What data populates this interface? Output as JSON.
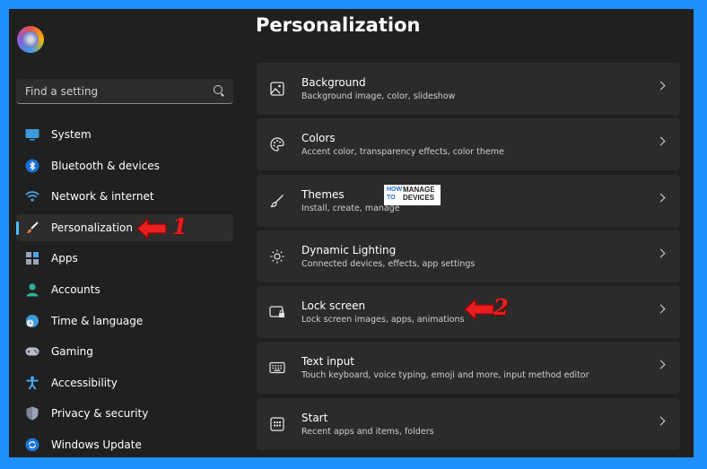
{
  "search": {
    "placeholder": "Find a setting"
  },
  "nav": {
    "items": [
      {
        "label": "System",
        "icon": "monitor-icon"
      },
      {
        "label": "Bluetooth & devices",
        "icon": "bluetooth-icon"
      },
      {
        "label": "Network & internet",
        "icon": "wifi-icon"
      },
      {
        "label": "Personalization",
        "icon": "brush-icon",
        "selected": true
      },
      {
        "label": "Apps",
        "icon": "apps-icon"
      },
      {
        "label": "Accounts",
        "icon": "person-icon"
      },
      {
        "label": "Time & language",
        "icon": "globe-clock-icon"
      },
      {
        "label": "Gaming",
        "icon": "controller-icon"
      },
      {
        "label": "Accessibility",
        "icon": "accessibility-icon"
      },
      {
        "label": "Privacy & security",
        "icon": "shield-icon"
      },
      {
        "label": "Windows Update",
        "icon": "update-icon"
      }
    ]
  },
  "page": {
    "title": "Personalization"
  },
  "cards": [
    {
      "title": "Background",
      "subtitle": "Background image, color, slideshow",
      "icon": "image-icon"
    },
    {
      "title": "Colors",
      "subtitle": "Accent color, transparency effects, color theme",
      "icon": "palette-icon"
    },
    {
      "title": "Themes",
      "subtitle": "Install, create, manage",
      "icon": "brush-icon"
    },
    {
      "title": "Dynamic Lighting",
      "subtitle": "Connected devices, effects, app settings",
      "icon": "lighting-icon"
    },
    {
      "title": "Lock screen",
      "subtitle": "Lock screen images, apps, animations",
      "icon": "lock-screen-icon"
    },
    {
      "title": "Text input",
      "subtitle": "Touch keyboard, voice typing, emoji and more, input method editor",
      "icon": "keyboard-icon"
    },
    {
      "title": "Start",
      "subtitle": "Recent apps and items, folders",
      "icon": "start-icon"
    }
  ],
  "annotations": {
    "one": "1",
    "two": "2"
  },
  "watermark": {
    "line1": "HOW",
    "line2": "TO",
    "line3": "MANAGE",
    "line4": "DEVICES"
  },
  "colors": {
    "accent": "#4cc2ff",
    "annotation": "#e81f1f",
    "frame": "#1e90ff"
  }
}
